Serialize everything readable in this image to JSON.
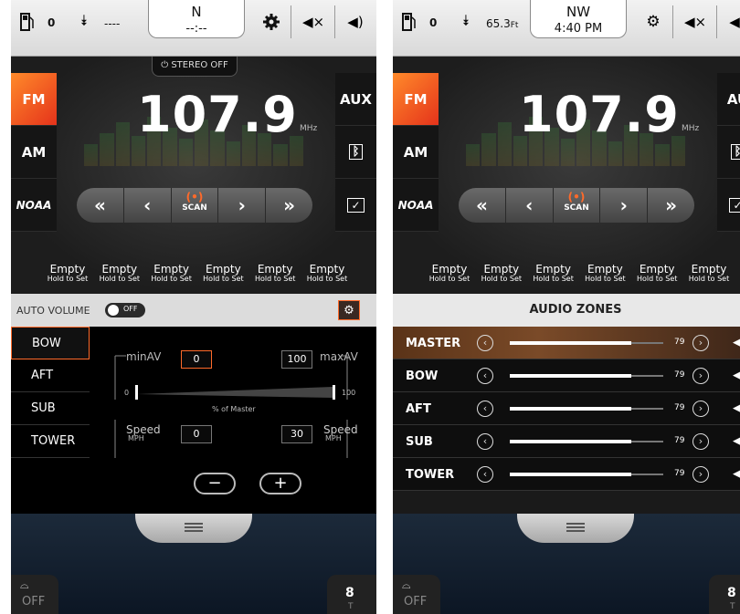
{
  "left": {
    "status": {
      "fuel": "0",
      "depth": "----",
      "heading": "N",
      "time": "--:--"
    },
    "stereo": "STEREO OFF",
    "frequency": "107.9",
    "unit": "MHz",
    "bands": [
      "FM",
      "AM"
    ],
    "sources": [
      "AUX"
    ],
    "scan": "SCAN",
    "presets": [
      {
        "label": "Empty",
        "sub": "Hold to Set"
      },
      {
        "label": "Empty",
        "sub": "Hold to Set"
      },
      {
        "label": "Empty",
        "sub": "Hold to Set"
      },
      {
        "label": "Empty",
        "sub": "Hold to Set"
      },
      {
        "label": "Empty",
        "sub": "Hold to Set"
      },
      {
        "label": "Empty",
        "sub": "Hold to Set"
      }
    ],
    "auto_volume": {
      "label": "AUTO VOLUME",
      "toggle": "OFF"
    },
    "zones": [
      "BOW",
      "AFT",
      "SUB",
      "TOWER"
    ],
    "av": {
      "min_label": "minAV",
      "min_value": "0",
      "max_label": "maxAV",
      "max_value": "100",
      "scale_min": "0",
      "scale_max": "100",
      "scale_label": "% of Master",
      "speed_label": "Speed",
      "speed_unit": "MPH",
      "speed_min": "0",
      "speed_max": "30",
      "minus": "−",
      "plus": "+"
    },
    "bottom": {
      "cruise": "OFF",
      "gear": "8",
      "gear_sub": "T"
    }
  },
  "right": {
    "status": {
      "fuel": "0",
      "depth": "65.3",
      "depth_unit": "Ft",
      "heading": "NW",
      "time": "4:40 PM"
    },
    "frequency": "107.9",
    "unit": "MHz",
    "bands": [
      "FM",
      "AM"
    ],
    "sources": [
      "AU"
    ],
    "scan": "SCAN",
    "presets": [
      {
        "label": "Empty",
        "sub": "Hold to Set"
      },
      {
        "label": "Empty",
        "sub": "Hold to Set"
      },
      {
        "label": "Empty",
        "sub": "Hold to Set"
      },
      {
        "label": "Empty",
        "sub": "Hold to Set"
      },
      {
        "label": "Empty",
        "sub": "Hold to Set"
      },
      {
        "label": "Empty",
        "sub": "Hold to Set"
      }
    ],
    "zones_title": "AUDIO ZONES",
    "zones": [
      {
        "name": "MASTER",
        "value": "79",
        "level": 0.79
      },
      {
        "name": "BOW",
        "value": "79",
        "level": 0.79
      },
      {
        "name": "AFT",
        "value": "79",
        "level": 0.79
      },
      {
        "name": "SUB",
        "value": "79",
        "level": 0.79
      },
      {
        "name": "TOWER",
        "value": "79",
        "level": 0.79
      }
    ],
    "bottom": {
      "cruise": "OFF",
      "gear": "8",
      "gear_sub": "T"
    }
  },
  "colors": {
    "accent": "#ff6a2a",
    "active_band": "#e5331b"
  }
}
